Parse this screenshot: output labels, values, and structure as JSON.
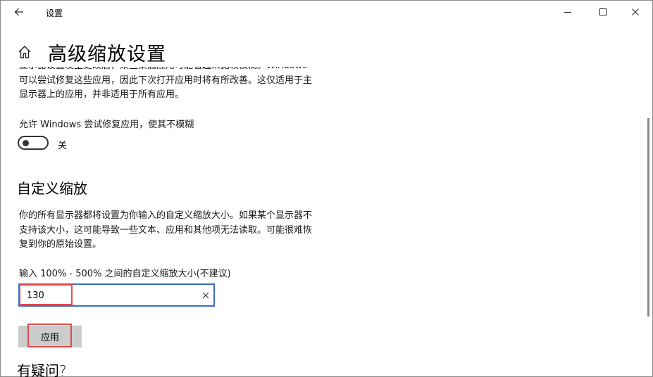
{
  "window": {
    "title": "设置"
  },
  "header": {
    "page_title": "高级缩放设置"
  },
  "fix_apps": {
    "description": "显示器设置发生更改后，某些桌面应用可能看起来比较模糊。Windows 可以尝试修复这些应用，因此下次打开应用时将有所改善。这仅适用于主显示器上的应用，并非适用于所有应用。",
    "description_partial": "显示器设置发生更改后，某些桌面应用可能看起来比较模糊。Windows",
    "description_line2": "可以尝试修复这些应用，因此下次打开应用时将有所改善。这仅适用于主",
    "description_line3": "显示器上的应用，并非适用于所有应用。",
    "toggle_label": "允许 Windows 尝试修复应用，使其不模糊",
    "toggle_state": "关",
    "toggle_on": false
  },
  "custom_scaling": {
    "section_title": "自定义缩放",
    "description_line1": "你的所有显示器都将设置为你输入的自定义缩放大小。如果某个显示器不",
    "description_line2": "支持该大小，这可能导致一些文本、应用和其他项无法读取。可能很难恢",
    "description_line3": "复到你的原始设置。",
    "input_label": "输入 100% - 500% 之间的自定义缩放大小(不建议)",
    "input_value": "130",
    "apply_label": "应用"
  },
  "help": {
    "section_title": "有疑问?"
  },
  "colors": {
    "accent": "#3a6fc4",
    "highlight": "#e04a50",
    "button_bg": "#cccccc"
  },
  "icons": [
    "back-arrow-icon",
    "minimize-icon",
    "maximize-icon",
    "close-icon",
    "home-icon",
    "clear-icon"
  ]
}
